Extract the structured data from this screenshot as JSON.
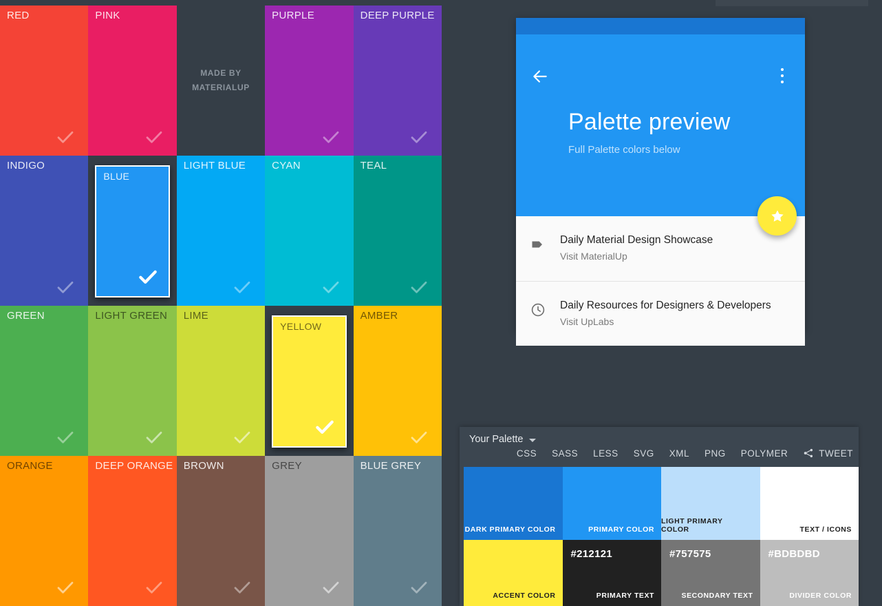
{
  "branding": {
    "line1": "MADE BY",
    "line2": "MATERIALUP"
  },
  "swatch_grid": {
    "swatches": [
      {
        "name": "RED",
        "hex": "#F44336",
        "dark_text": false,
        "selected": false
      },
      {
        "name": "PINK",
        "hex": "#E91E63",
        "dark_text": false,
        "selected": false
      },
      {
        "name": "",
        "hex": "",
        "dark_text": false,
        "selected": false,
        "branding": true
      },
      {
        "name": "PURPLE",
        "hex": "#9C27B0",
        "dark_text": false,
        "selected": false
      },
      {
        "name": "DEEP PURPLE",
        "hex": "#673AB7",
        "dark_text": false,
        "selected": false
      },
      {
        "name": "INDIGO",
        "hex": "#3F51B5",
        "dark_text": false,
        "selected": false
      },
      {
        "name": "BLUE",
        "hex": "#2196F3",
        "dark_text": false,
        "selected": true
      },
      {
        "name": "LIGHT BLUE",
        "hex": "#03A9F4",
        "dark_text": false,
        "selected": false
      },
      {
        "name": "CYAN",
        "hex": "#00BCD4",
        "dark_text": false,
        "selected": false
      },
      {
        "name": "TEAL",
        "hex": "#009688",
        "dark_text": false,
        "selected": false
      },
      {
        "name": "GREEN",
        "hex": "#4CAF50",
        "dark_text": false,
        "selected": false
      },
      {
        "name": "LIGHT GREEN",
        "hex": "#8BC34A",
        "dark_text": true,
        "selected": false
      },
      {
        "name": "LIME",
        "hex": "#CDDC39",
        "dark_text": true,
        "selected": false
      },
      {
        "name": "YELLOW",
        "hex": "#FFEB3B",
        "dark_text": true,
        "selected": true
      },
      {
        "name": "AMBER",
        "hex": "#FFC107",
        "dark_text": true,
        "selected": false
      },
      {
        "name": "ORANGE",
        "hex": "#FF9800",
        "dark_text": true,
        "selected": false
      },
      {
        "name": "DEEP ORANGE",
        "hex": "#FF5722",
        "dark_text": false,
        "selected": false
      },
      {
        "name": "BROWN",
        "hex": "#795548",
        "dark_text": false,
        "selected": false
      },
      {
        "name": "GREY",
        "hex": "#9E9E9E",
        "dark_text": true,
        "selected": false
      },
      {
        "name": "BLUE GREY",
        "hex": "#607D8B",
        "dark_text": false,
        "selected": false
      }
    ]
  },
  "preview": {
    "title": "Palette preview",
    "subtitle": "Full Palette colors below",
    "back_icon": "back-arrow-icon",
    "overflow_icon": "overflow-menu-icon",
    "fab_icon": "star-icon",
    "fab_color": "#FFEB3B",
    "appbar_color": "#2196F3",
    "statusbar_color": "#1976D2",
    "list": [
      {
        "icon": "tag-icon",
        "title": "Daily Material Design Showcase",
        "subtitle": "Visit MaterialUp"
      },
      {
        "icon": "clock-icon",
        "title": "Daily Resources for Designers & Developers",
        "subtitle": "Visit UpLabs"
      }
    ]
  },
  "panel": {
    "title": "Your Palette",
    "chevron_icon": "chevron-down-icon",
    "export_formats": [
      "CSS",
      "SASS",
      "LESS",
      "SVG",
      "XML",
      "PNG",
      "POLYMER"
    ],
    "tweet_label": "TWEET",
    "tweet_icon": "share-icon",
    "cells": [
      {
        "name": "DARK PRIMARY COLOR",
        "hex": "",
        "bg": "#1976D2",
        "name_color": "#FFFFFF",
        "hex_color": "#FFFFFF"
      },
      {
        "name": "PRIMARY COLOR",
        "hex": "",
        "bg": "#2196F3",
        "name_color": "#FFFFFF",
        "hex_color": "#FFFFFF"
      },
      {
        "name": "LIGHT PRIMARY COLOR",
        "hex": "",
        "bg": "#BBDEFB",
        "name_color": "#212121",
        "hex_color": "#212121"
      },
      {
        "name": "TEXT / ICONS",
        "hex": "",
        "bg": "#FFFFFF",
        "name_color": "#212121",
        "hex_color": "#212121"
      },
      {
        "name": "ACCENT COLOR",
        "hex": "",
        "bg": "#FFEB3B",
        "name_color": "#212121",
        "hex_color": "#212121"
      },
      {
        "name": "PRIMARY TEXT",
        "hex": "#212121",
        "bg": "#212121",
        "name_color": "#FFFFFF",
        "hex_color": "#FFFFFF"
      },
      {
        "name": "SECONDARY TEXT",
        "hex": "#757575",
        "bg": "#757575",
        "name_color": "#FFFFFF",
        "hex_color": "#FFFFFF"
      },
      {
        "name": "DIVIDER COLOR",
        "hex": "#BDBDBD",
        "bg": "#BDBDBD",
        "name_color": "#FFFFFF",
        "hex_color": "#FFFFFF"
      }
    ]
  }
}
